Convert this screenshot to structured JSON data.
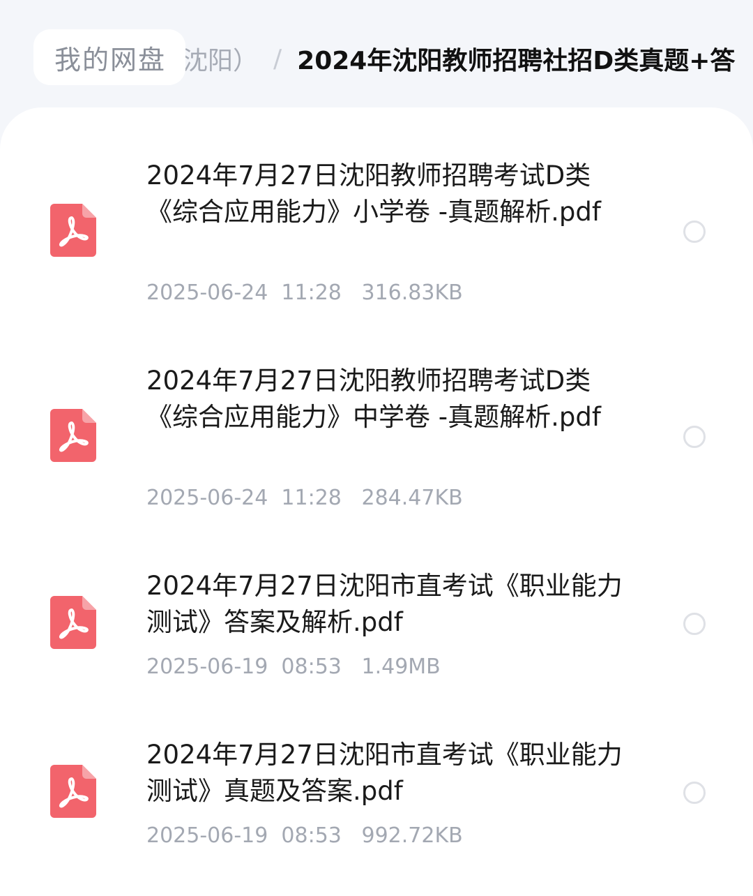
{
  "breadcrumb": {
    "root_label": "我的网盘",
    "parent_label": "沈阳）",
    "separator": "/",
    "current_label": "2024年沈阳教师招聘社招D类真题+答"
  },
  "files": [
    {
      "name": "2024年7月27日沈阳教师招聘考试D类《综合应用能力》小学卷 -真题解析.pdf",
      "meta": "2025-06-24  11:28   316.83KB",
      "icon": "pdf-icon",
      "selected": false
    },
    {
      "name": "2024年7月27日沈阳教师招聘考试D类《综合应用能力》中学卷 -真题解析.pdf",
      "meta": "2025-06-24  11:28   284.47KB",
      "icon": "pdf-icon",
      "selected": false
    },
    {
      "name": "2024年7月27日沈阳市直考试《职业能力测试》答案及解析.pdf",
      "meta": "2025-06-19  08:53   1.49MB",
      "icon": "pdf-icon",
      "selected": false
    },
    {
      "name": "2024年7月27日沈阳市直考试《职业能力测试》真题及答案.pdf",
      "meta": "2025-06-19  08:53   992.72KB",
      "icon": "pdf-icon",
      "selected": false
    }
  ],
  "colors": {
    "pdf_icon": "#f2646c",
    "background": "#f4f6fa",
    "card": "#ffffff"
  }
}
